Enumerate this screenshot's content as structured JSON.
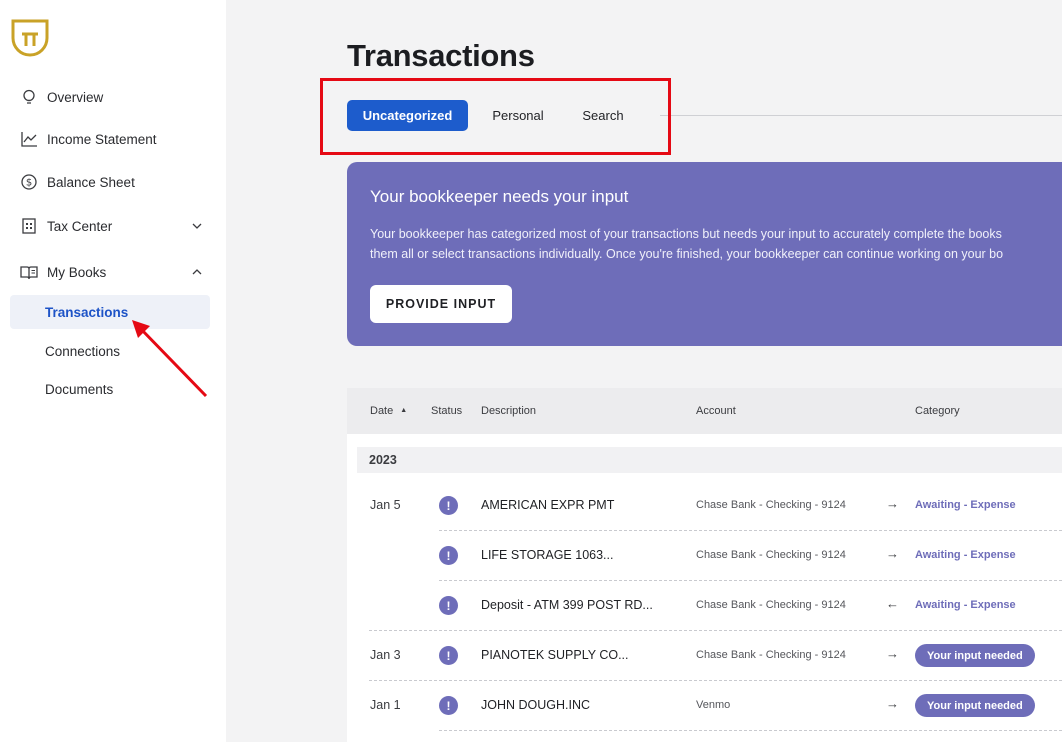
{
  "sidebar": {
    "items": [
      {
        "label": "Overview",
        "icon": "lightbulb-icon"
      },
      {
        "label": "Income Statement",
        "icon": "line-chart-icon"
      },
      {
        "label": "Balance Sheet",
        "icon": "dollar-circle-icon"
      },
      {
        "label": "Tax Center",
        "icon": "calculator-icon"
      },
      {
        "label": "My Books",
        "icon": "book-icon"
      }
    ],
    "sub_items": [
      {
        "label": "Transactions",
        "active": true
      },
      {
        "label": "Connections"
      },
      {
        "label": "Documents"
      }
    ]
  },
  "page": {
    "title": "Transactions"
  },
  "tabs": [
    {
      "label": "Uncategorized",
      "active": true
    },
    {
      "label": "Personal"
    },
    {
      "label": "Search"
    }
  ],
  "banner": {
    "title": "Your bookkeeper needs your input",
    "line1": "Your bookkeeper has categorized most of your transactions but needs your input to accurately complete the books",
    "line2": "them all or select transactions individually. Once you're finished, your bookkeeper can continue working on your bo",
    "button": "PROVIDE INPUT"
  },
  "table": {
    "headers": {
      "date": "Date",
      "status": "Status",
      "description": "Description",
      "account": "Account",
      "category": "Category"
    },
    "year": "2023",
    "rows": [
      {
        "date": "Jan 5",
        "description": "AMERICAN EXPR PMT",
        "account": "Chase Bank - Checking - 9124",
        "arrow": "→",
        "category": "Awaiting - Expense"
      },
      {
        "date": "",
        "description": "LIFE STORAGE 1063...",
        "account": "Chase Bank - Checking - 9124",
        "arrow": "→",
        "category": "Awaiting - Expense"
      },
      {
        "date": "",
        "description": "Deposit - ATM 399 POST RD...",
        "account": "Chase Bank - Checking - 9124",
        "arrow": "←",
        "category": "Awaiting - Expense"
      },
      {
        "date": "Jan 3",
        "description": "PIANOTEK SUPPLY CO...",
        "account": "Chase Bank - Checking - 9124",
        "arrow": "→",
        "category": "Your input needed"
      },
      {
        "date": "Jan 1",
        "description": "JOHN DOUGH.INC",
        "account": "Venmo",
        "arrow": "→",
        "category": "Your input needed"
      }
    ],
    "status_glyph": "!"
  },
  "colors": {
    "accent": "#1d5ccc",
    "purple": "#6e6db9",
    "logo_gold": "#c9a227",
    "highlight": "#e50914"
  }
}
